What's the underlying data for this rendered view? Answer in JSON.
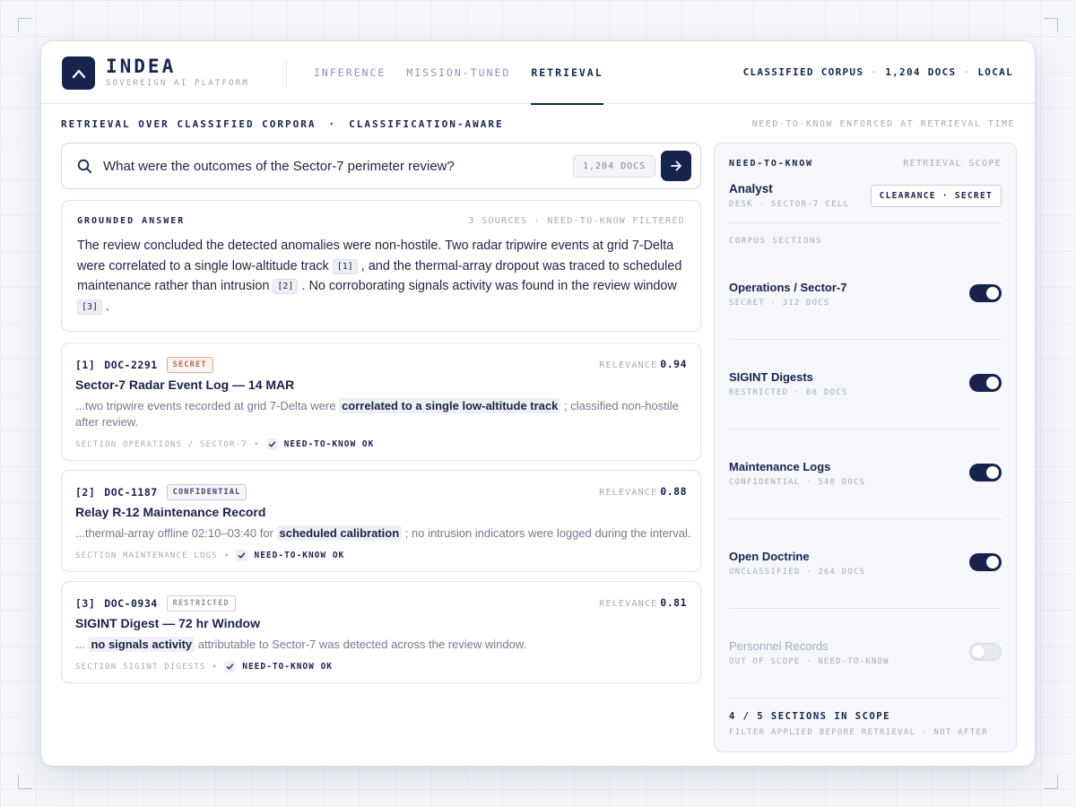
{
  "brand": {
    "name": "INDEA",
    "tagline": "SOVEREIGN AI PLATFORM"
  },
  "tabs": [
    {
      "label": "INFERENCE",
      "active": false
    },
    {
      "label": "MISSION-TUNED",
      "active": false
    },
    {
      "label": "RETRIEVAL",
      "active": true
    }
  ],
  "corpus_status": {
    "corpus": "CLASSIFIED CORPUS",
    "docs": "1,204 DOCS",
    "mode": "LOCAL",
    "sep": "·"
  },
  "subheader": {
    "left": "RETRIEVAL OVER CLASSIFIED CORPORA",
    "dot": "·",
    "mode": "CLASSIFICATION-AWARE",
    "right": "NEED-TO-KNOW ENFORCED AT RETRIEVAL TIME"
  },
  "search": {
    "query": "What were the outcomes of the Sector-7 perimeter review?",
    "docs_pill": "1,204 DOCS"
  },
  "answer": {
    "title": "GROUNDED ANSWER",
    "meta": "3 SOURCES · NEED-TO-KNOW FILTERED",
    "part1": "The review concluded the detected anomalies were non-hostile. Two radar tripwire events at grid 7-Delta were correlated to a single low-altitude track ",
    "cite1": "[1]",
    "part2": " , and the thermal-array dropout was traced to scheduled maintenance rather than intrusion ",
    "cite2": "[2]",
    "part3": " . No corroborating signals activity was found in the review window ",
    "cite3": "[3]",
    "part4": " ."
  },
  "results": [
    {
      "index": "[1]",
      "doc_id": "DOC-2291",
      "classification": "SECRET",
      "relevance_label": "RELEVANCE",
      "relevance": "0.94",
      "title": "Sector-7 Radar Event Log — 14 MAR",
      "snippet_pre": "...two tripwire events recorded at grid 7-Delta were ",
      "snippet_hl": "correlated to a single low-altitude track",
      "snippet_post": " ; classified non-hostile after review.",
      "section": "SECTION OPERATIONS / SECTOR-7",
      "bullet": "•",
      "ntk": "NEED-TO-KNOW OK"
    },
    {
      "index": "[2]",
      "doc_id": "DOC-1187",
      "classification": "CONFIDENTIAL",
      "relevance_label": "RELEVANCE",
      "relevance": "0.88",
      "title": "Relay R-12 Maintenance Record",
      "snippet_pre": "...thermal-array offline 02:10–03:40 for ",
      "snippet_hl": "scheduled calibration",
      "snippet_post": " ; no intrusion indicators were logged during the interval.",
      "section": "SECTION MAINTENANCE LOGS",
      "bullet": "•",
      "ntk": "NEED-TO-KNOW OK"
    },
    {
      "index": "[3]",
      "doc_id": "DOC-0934",
      "classification": "RESTRICTED",
      "relevance_label": "RELEVANCE",
      "relevance": "0.81",
      "title": "SIGINT Digest — 72 hr Window",
      "snippet_pre": "... ",
      "snippet_hl": "no signals activity",
      "snippet_post": " attributable to Sector-7 was detected across the review window.",
      "section": "SECTION SIGINT DIGESTS",
      "bullet": "•",
      "ntk": "NEED-TO-KNOW OK"
    }
  ],
  "panel": {
    "title": "NEED-TO-KNOW",
    "scope_label": "RETRIEVAL SCOPE",
    "role": "Analyst",
    "desk": "DESK · SECTOR-7 CELL",
    "clearance": "CLEARANCE · SECRET",
    "sections_label": "CORPUS SECTIONS",
    "sections": [
      {
        "name": "Operations / Sector-7",
        "meta": "SECRET · 312 DOCS",
        "enabled": true
      },
      {
        "name": "SIGINT Digests",
        "meta": "RESTRICTED · 88 DOCS",
        "enabled": true
      },
      {
        "name": "Maintenance Logs",
        "meta": "CONFIDENTIAL · 540 DOCS",
        "enabled": true
      },
      {
        "name": "Open Doctrine",
        "meta": "UNCLASSIFIED · 264 DOCS",
        "enabled": true
      },
      {
        "name": "Personnel Records",
        "meta": "OUT OF SCOPE · NEED-TO-KNOW",
        "enabled": false
      }
    ],
    "summary": "4 / 5 SECTIONS IN SCOPE",
    "filter_note": "FILTER APPLIED BEFORE RETRIEVAL · NOT AFTER"
  },
  "colors": {
    "navy": "#17234d",
    "secret": "#b06a4f",
    "muted": "#a2abbd"
  },
  "icons": {
    "logo": "chevron-up-icon",
    "search": "search-icon",
    "go": "arrow-right-icon",
    "check": "check-icon"
  }
}
